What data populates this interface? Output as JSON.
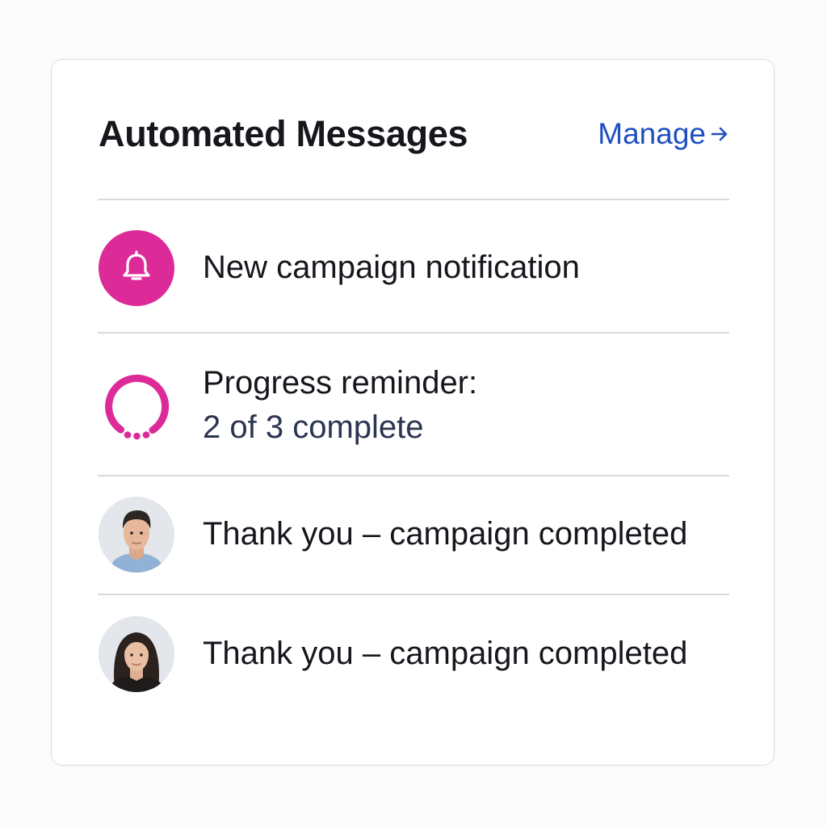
{
  "panel": {
    "title": "Automated Messages",
    "manage_label": "Manage",
    "manage_icon": "arrow-right-icon",
    "accent_color": "#dd2a99",
    "link_color": "#1f4fc1"
  },
  "messages": [
    {
      "icon": "bell-icon",
      "label": "New campaign notification"
    },
    {
      "icon": "progress-ring-icon",
      "label": "Progress reminder:",
      "sub_label": "2 of 3 complete"
    },
    {
      "icon": "avatar-man",
      "label": "Thank you – campaign completed"
    },
    {
      "icon": "avatar-woman",
      "label": "Thank you – campaign completed"
    }
  ]
}
